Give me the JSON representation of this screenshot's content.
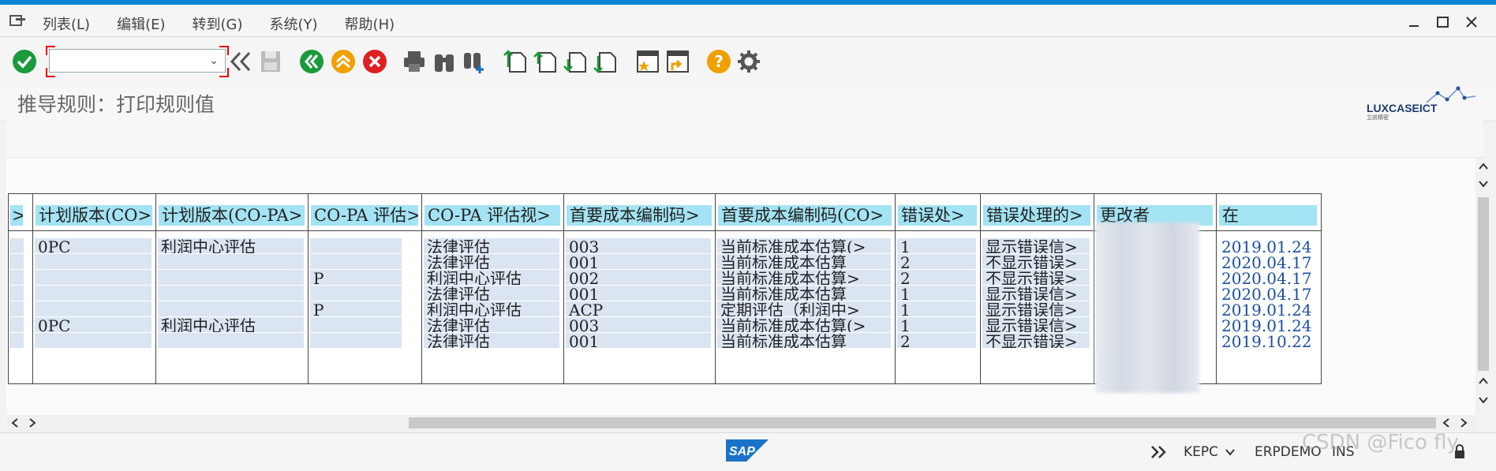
{
  "menubar": {
    "items": [
      "列表(L)",
      "编辑(E)",
      "转到(G)",
      "系统(Y)",
      "帮助(H)"
    ]
  },
  "toolbar": {
    "command_value": "",
    "icons": [
      "enter-check",
      "back",
      "exit",
      "cancel",
      "print",
      "find",
      "find-next",
      "first-page",
      "previous-page",
      "next-page",
      "last-page",
      "create-session",
      "shortcut",
      "help",
      "customize-layout"
    ]
  },
  "page": {
    "title": "推导规则：打印规则值",
    "logo_text": "LUXCASEICT",
    "logo_subtext": "立凯精密"
  },
  "table": {
    "headers": [
      "计划版本(CO>",
      "计划版本(CO-PA>",
      "CO-PA 评估>",
      "CO-PA 评估视>",
      "首要成本编制码>",
      "首要成本编制码(CO>",
      "错误处>",
      "错误处理的>",
      "更改者",
      "在"
    ],
    "rows": [
      [
        "0PC",
        "利润中心评估",
        "",
        "法律评估",
        "003",
        "当前标准成本估算(>",
        "1",
        "显示错误信>",
        "",
        "2019.01.24"
      ],
      [
        "",
        "",
        "",
        "法律评估",
        "001",
        "当前标准成本估算",
        "2",
        "不显示错误>",
        "",
        "2020.04.17"
      ],
      [
        "",
        "",
        "P",
        "利润中心评估",
        "002",
        "当前标准成本估算>",
        "2",
        "不显示错误>",
        "",
        "2020.04.17"
      ],
      [
        "",
        "",
        "",
        "法律评估",
        "001",
        "当前标准成本估算",
        "1",
        "显示错误信>",
        "",
        "2020.04.17"
      ],
      [
        "",
        "",
        "P",
        "利润中心评估",
        "ACP",
        "定期评估（利润中>",
        "1",
        "显示错误信>",
        "",
        "2019.01.24"
      ],
      [
        "0PC",
        "利润中心评估",
        "",
        "法律评估",
        "003",
        "当前标准成本估算(>",
        "1",
        "显示错误信>",
        "",
        "2019.01.24"
      ],
      [
        "",
        "",
        "",
        "法律评估",
        "001",
        "当前标准成本估算",
        "2",
        "不显示错误>",
        "",
        "2019.10.22"
      ]
    ]
  },
  "statusbar": {
    "sap_logo": "SAP",
    "system": "KEPC",
    "server": "ERPDEMO",
    "mode": "INS",
    "watermark": "CSDN @Fico fly"
  },
  "colors": {
    "accent_blue": "#0a84d6",
    "header_cyan": "#a3e3f3",
    "cell_blue": "#dbe5f2",
    "date_blue": "#1b4fa0"
  }
}
